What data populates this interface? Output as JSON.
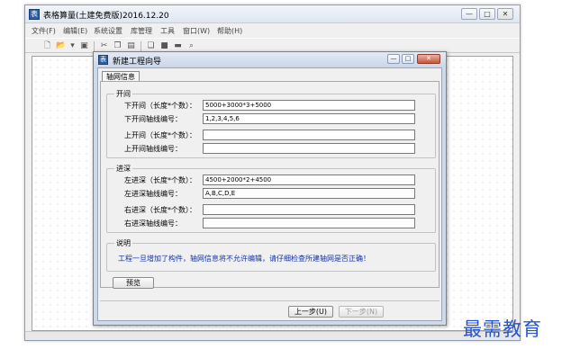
{
  "window": {
    "title": "表格算量(土建免费版)2016.12.20",
    "minimize": "—",
    "maximize": "□",
    "close": "✕"
  },
  "menu": {
    "file": "文件(F)",
    "edit": "编辑(E)",
    "system": "系统设置",
    "library": "库管理",
    "tools": "工具",
    "window": "窗口(W)",
    "help": "帮助(H)"
  },
  "toolbar_icons": [
    "new-file-icon",
    "open-folder-icon",
    "dropdown-arrow-icon",
    "save-icon",
    "cut-icon",
    "copy-icon",
    "paste-icon",
    "block-copy-icon",
    "block-icon",
    "block-dark-icon",
    "zoom-icon"
  ],
  "dialog": {
    "title": "新建工程向导",
    "tab": "轴网信息",
    "bay_group": {
      "legend": "开间",
      "lower_bay_label": "下开间（长度*个数）：",
      "lower_bay_value": "5000+3000*3+5000",
      "lower_axis_label": "下开间轴线编号：",
      "lower_axis_value": "1,2,3,4,5,6",
      "upper_bay_label": "上开间（长度*个数）：",
      "upper_bay_value": "",
      "upper_axis_label": "上开间轴线编号：",
      "upper_axis_value": ""
    },
    "depth_group": {
      "legend": "进深",
      "left_depth_label": "左进深（长度*个数）：",
      "left_depth_value": "4500+2000*2+4500",
      "left_axis_label": "左进深轴线编号：",
      "left_axis_value": "A,B,C,D,E",
      "right_depth_label": "右进深（长度*个数）：",
      "right_depth_value": "",
      "right_axis_label": "右进深轴线编号：",
      "right_axis_value": ""
    },
    "note_group": {
      "legend": "说明",
      "text": "工程一旦增加了构件，轴网信息将不允许编辑，请仔细检查所建轴网是否正确！"
    },
    "preview_button": "预览",
    "prev_button": "上一步(U)",
    "next_button": "下一步(N)"
  },
  "watermark": "最需教育",
  "colors": {
    "note_text": "#1633a8",
    "watermark": "#2a55c9",
    "dialog_frame": "#cfd9e8"
  }
}
